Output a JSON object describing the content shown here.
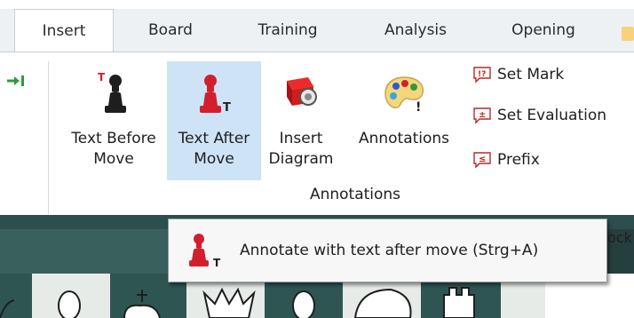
{
  "tabs": [
    {
      "label": "Insert",
      "active": true
    },
    {
      "label": "Board",
      "active": false
    },
    {
      "label": "Training",
      "active": false
    },
    {
      "label": "Analysis",
      "active": false
    },
    {
      "label": "Opening",
      "active": false
    }
  ],
  "ribbon": {
    "buttons": [
      {
        "label_line1": "Text Before",
        "label_line2": "Move",
        "icon": "pawn-text-before-icon"
      },
      {
        "label_line1": "Text After",
        "label_line2": "Move",
        "icon": "pawn-text-after-icon",
        "selected": true
      },
      {
        "label_line1": "Insert",
        "label_line2": "Diagram",
        "icon": "insert-diagram-icon"
      },
      {
        "label_line1": "Annotations",
        "label_line2": "",
        "icon": "palette-icon"
      }
    ],
    "small_buttons": [
      {
        "label": "Set Mark",
        "icon": "mark-icon",
        "glyph": "!?"
      },
      {
        "label": "Set Evaluation",
        "icon": "evaluation-icon",
        "glyph": "±"
      },
      {
        "label": "Prefix",
        "icon": "prefix-icon",
        "glyph": "≤"
      }
    ],
    "group_label": "Annotations"
  },
  "tooltip": {
    "text": "Annotate with text after move (Strg+A)",
    "icon": "pawn-text-after-icon"
  },
  "partial_panel_text": "ock",
  "colors": {
    "accent_selected": "#cfe3f7",
    "pawn_red": "#d21f2c",
    "board_dark": "#2f5553",
    "board_light": "#e7ebe8",
    "tooltip_bg": "#f7f7f7"
  }
}
